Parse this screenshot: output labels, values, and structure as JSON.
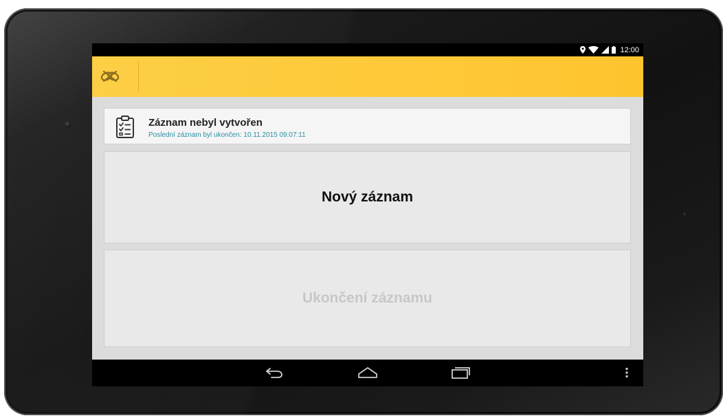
{
  "status_bar": {
    "time": "12:00",
    "icons": [
      "location-icon",
      "wifi-icon",
      "signal-icon",
      "battery-icon"
    ]
  },
  "app_bar": {
    "logo_icon": "app-logo-icon",
    "background_color": "#fec42e"
  },
  "info_card": {
    "icon": "clipboard-checklist-icon",
    "title": "Záznam nebyl vytvořen",
    "subtitle": "Poslední záznam byl ukončen: 10.11.2015 09:07:11",
    "subtitle_color": "#2a8fa5"
  },
  "actions": {
    "new_record_label": "Nový záznam",
    "end_record_label": "Ukončení záznamu",
    "end_record_enabled": false
  },
  "nav_bar": {
    "icons": [
      "back-icon",
      "home-icon",
      "recent-apps-icon",
      "overflow-menu-icon"
    ]
  }
}
